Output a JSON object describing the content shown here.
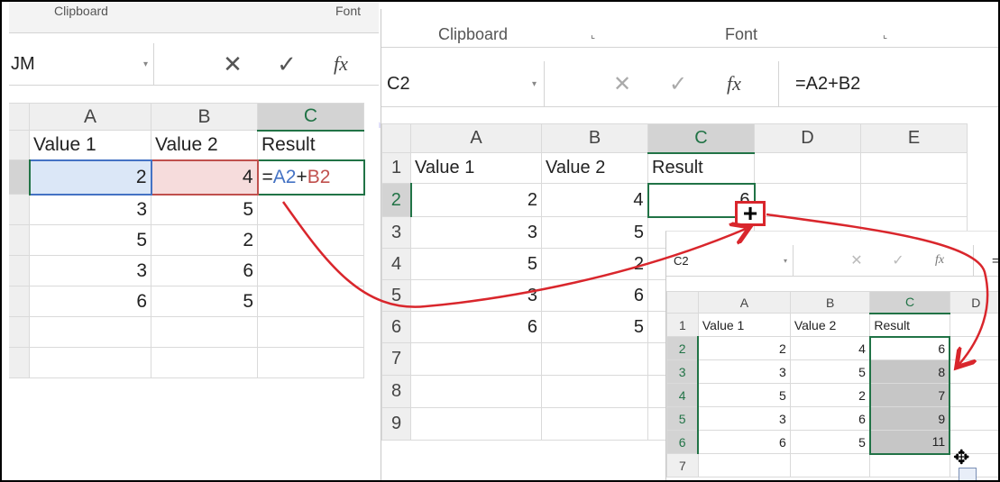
{
  "left": {
    "ribbon_clipboard": "Clipboard",
    "ribbon_font": "Font",
    "namebox": "JM",
    "formula_cancel": "✕",
    "formula_enter": "✓",
    "formula_fx": "fx",
    "columns": [
      "A",
      "B",
      "C"
    ],
    "rows": [
      [
        "Value 1",
        "Value 2",
        "Result"
      ],
      [
        "2",
        "4",
        ""
      ],
      [
        "3",
        "5",
        ""
      ],
      [
        "5",
        "2",
        ""
      ],
      [
        "3",
        "6",
        ""
      ],
      [
        "6",
        "5",
        ""
      ],
      [
        "",
        "",
        ""
      ],
      [
        "",
        "",
        ""
      ]
    ],
    "edit_formula": {
      "eq": "=",
      "a2": "A2",
      "plus": "+",
      "b2": "B2"
    }
  },
  "middle": {
    "ribbon_clipboard": "Clipboard",
    "ribbon_font": "Font",
    "namebox": "C2",
    "formula_cancel": "✕",
    "formula_enter": "✓",
    "formula_fx": "fx",
    "formula": "=A2+B2",
    "columns": [
      "A",
      "B",
      "C",
      "D",
      "E"
    ],
    "row_numbers": [
      "1",
      "2",
      "3",
      "4",
      "5",
      "6",
      "7",
      "8",
      "9"
    ],
    "rows": [
      [
        "Value 1",
        "Value 2",
        "Result",
        "",
        ""
      ],
      [
        "2",
        "4",
        "6",
        "",
        ""
      ],
      [
        "3",
        "5",
        "",
        "",
        ""
      ],
      [
        "5",
        "2",
        "",
        "",
        ""
      ],
      [
        "3",
        "6",
        "",
        "",
        ""
      ],
      [
        "6",
        "5",
        "",
        "",
        ""
      ],
      [
        "",
        "",
        "",
        "",
        ""
      ],
      [
        "",
        "",
        "",
        "",
        ""
      ],
      [
        "",
        "",
        "",
        "",
        ""
      ]
    ],
    "fill_handle_glyph": "+"
  },
  "right": {
    "namebox": "C2",
    "formula_cancel": "✕",
    "formula_enter": "✓",
    "formula_fx": "fx",
    "formula_clip": "=",
    "columns": [
      "A",
      "B",
      "C",
      "D"
    ],
    "row_numbers": [
      "1",
      "2",
      "3",
      "4",
      "5",
      "6",
      "7"
    ],
    "rows": [
      [
        "Value 1",
        "Value 2",
        "Result",
        ""
      ],
      [
        "2",
        "4",
        "6",
        ""
      ],
      [
        "3",
        "5",
        "8",
        ""
      ],
      [
        "5",
        "2",
        "7",
        ""
      ],
      [
        "3",
        "6",
        "9",
        ""
      ],
      [
        "6",
        "5",
        "11",
        ""
      ],
      [
        "",
        "",
        "",
        ""
      ]
    ]
  },
  "colors": {
    "arrow": "#d9262c",
    "excel_green": "#217346",
    "ref_blue": "#4472c4",
    "ref_red": "#c0504d"
  }
}
